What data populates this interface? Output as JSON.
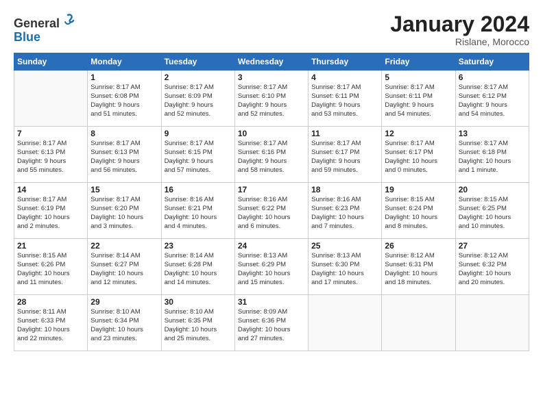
{
  "header": {
    "logo_line1": "General",
    "logo_line2": "Blue",
    "month_year": "January 2024",
    "location": "Rislane, Morocco"
  },
  "weekdays": [
    "Sunday",
    "Monday",
    "Tuesday",
    "Wednesday",
    "Thursday",
    "Friday",
    "Saturday"
  ],
  "weeks": [
    [
      {
        "num": "",
        "info": ""
      },
      {
        "num": "1",
        "info": "Sunrise: 8:17 AM\nSunset: 6:08 PM\nDaylight: 9 hours\nand 51 minutes."
      },
      {
        "num": "2",
        "info": "Sunrise: 8:17 AM\nSunset: 6:09 PM\nDaylight: 9 hours\nand 52 minutes."
      },
      {
        "num": "3",
        "info": "Sunrise: 8:17 AM\nSunset: 6:10 PM\nDaylight: 9 hours\nand 52 minutes."
      },
      {
        "num": "4",
        "info": "Sunrise: 8:17 AM\nSunset: 6:11 PM\nDaylight: 9 hours\nand 53 minutes."
      },
      {
        "num": "5",
        "info": "Sunrise: 8:17 AM\nSunset: 6:11 PM\nDaylight: 9 hours\nand 54 minutes."
      },
      {
        "num": "6",
        "info": "Sunrise: 8:17 AM\nSunset: 6:12 PM\nDaylight: 9 hours\nand 54 minutes."
      }
    ],
    [
      {
        "num": "7",
        "info": "Sunrise: 8:17 AM\nSunset: 6:13 PM\nDaylight: 9 hours\nand 55 minutes."
      },
      {
        "num": "8",
        "info": "Sunrise: 8:17 AM\nSunset: 6:13 PM\nDaylight: 9 hours\nand 56 minutes."
      },
      {
        "num": "9",
        "info": "Sunrise: 8:17 AM\nSunset: 6:15 PM\nDaylight: 9 hours\nand 57 minutes."
      },
      {
        "num": "10",
        "info": "Sunrise: 8:17 AM\nSunset: 6:16 PM\nDaylight: 9 hours\nand 58 minutes."
      },
      {
        "num": "11",
        "info": "Sunrise: 8:17 AM\nSunset: 6:17 PM\nDaylight: 9 hours\nand 59 minutes."
      },
      {
        "num": "12",
        "info": "Sunrise: 8:17 AM\nSunset: 6:17 PM\nDaylight: 10 hours\nand 0 minutes."
      },
      {
        "num": "13",
        "info": "Sunrise: 8:17 AM\nSunset: 6:18 PM\nDaylight: 10 hours\nand 1 minute."
      }
    ],
    [
      {
        "num": "14",
        "info": "Sunrise: 8:17 AM\nSunset: 6:19 PM\nDaylight: 10 hours\nand 2 minutes."
      },
      {
        "num": "15",
        "info": "Sunrise: 8:17 AM\nSunset: 6:20 PM\nDaylight: 10 hours\nand 3 minutes."
      },
      {
        "num": "16",
        "info": "Sunrise: 8:16 AM\nSunset: 6:21 PM\nDaylight: 10 hours\nand 4 minutes."
      },
      {
        "num": "17",
        "info": "Sunrise: 8:16 AM\nSunset: 6:22 PM\nDaylight: 10 hours\nand 6 minutes."
      },
      {
        "num": "18",
        "info": "Sunrise: 8:16 AM\nSunset: 6:23 PM\nDaylight: 10 hours\nand 7 minutes."
      },
      {
        "num": "19",
        "info": "Sunrise: 8:15 AM\nSunset: 6:24 PM\nDaylight: 10 hours\nand 8 minutes."
      },
      {
        "num": "20",
        "info": "Sunrise: 8:15 AM\nSunset: 6:25 PM\nDaylight: 10 hours\nand 10 minutes."
      }
    ],
    [
      {
        "num": "21",
        "info": "Sunrise: 8:15 AM\nSunset: 6:26 PM\nDaylight: 10 hours\nand 11 minutes."
      },
      {
        "num": "22",
        "info": "Sunrise: 8:14 AM\nSunset: 6:27 PM\nDaylight: 10 hours\nand 12 minutes."
      },
      {
        "num": "23",
        "info": "Sunrise: 8:14 AM\nSunset: 6:28 PM\nDaylight: 10 hours\nand 14 minutes."
      },
      {
        "num": "24",
        "info": "Sunrise: 8:13 AM\nSunset: 6:29 PM\nDaylight: 10 hours\nand 15 minutes."
      },
      {
        "num": "25",
        "info": "Sunrise: 8:13 AM\nSunset: 6:30 PM\nDaylight: 10 hours\nand 17 minutes."
      },
      {
        "num": "26",
        "info": "Sunrise: 8:12 AM\nSunset: 6:31 PM\nDaylight: 10 hours\nand 18 minutes."
      },
      {
        "num": "27",
        "info": "Sunrise: 8:12 AM\nSunset: 6:32 PM\nDaylight: 10 hours\nand 20 minutes."
      }
    ],
    [
      {
        "num": "28",
        "info": "Sunrise: 8:11 AM\nSunset: 6:33 PM\nDaylight: 10 hours\nand 22 minutes."
      },
      {
        "num": "29",
        "info": "Sunrise: 8:10 AM\nSunset: 6:34 PM\nDaylight: 10 hours\nand 23 minutes."
      },
      {
        "num": "30",
        "info": "Sunrise: 8:10 AM\nSunset: 6:35 PM\nDaylight: 10 hours\nand 25 minutes."
      },
      {
        "num": "31",
        "info": "Sunrise: 8:09 AM\nSunset: 6:36 PM\nDaylight: 10 hours\nand 27 minutes."
      },
      {
        "num": "",
        "info": ""
      },
      {
        "num": "",
        "info": ""
      },
      {
        "num": "",
        "info": ""
      }
    ]
  ]
}
